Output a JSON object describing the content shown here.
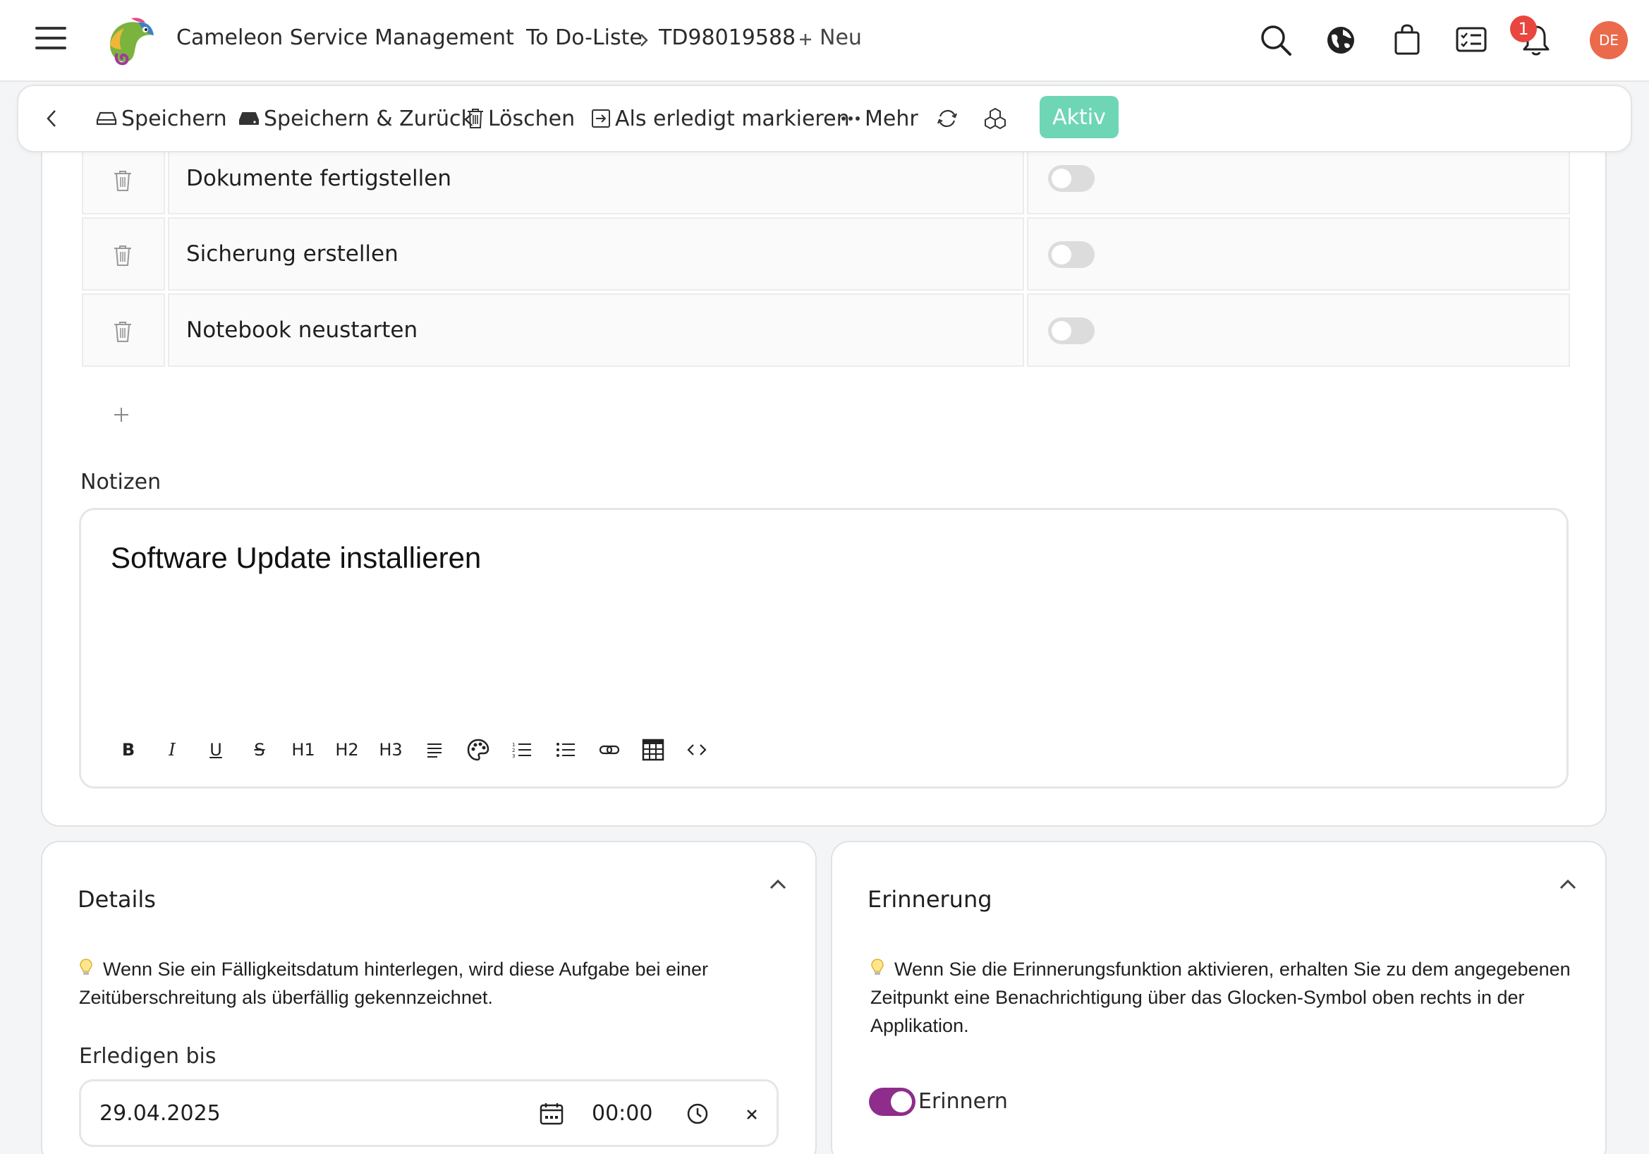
{
  "header": {
    "app_title": "Cameleon Service Management",
    "breadcrumb": {
      "parent": "To Do-Liste",
      "current": "TD98019588"
    },
    "new_label": "Neu",
    "notification_count": "1",
    "avatar_initials": "DE"
  },
  "toolbar": {
    "save_label": "Speichern",
    "save_back_label": "Speichern & Zurück",
    "delete_label": "Löschen",
    "mark_done_label": "Als erledigt markieren",
    "more_label": "Mehr",
    "status_label": "Aktiv",
    "status_color": "#6fd6b5"
  },
  "checklist": {
    "items": [
      {
        "text": "Dokumente fertigstellen",
        "done": false
      },
      {
        "text": "Sicherung erstellen",
        "done": false
      },
      {
        "text": "Notebook neustarten",
        "done": false
      }
    ]
  },
  "notes": {
    "label": "Notizen",
    "content": "Software Update installieren",
    "tools": [
      "B",
      "I",
      "U",
      "S",
      "H1",
      "H2",
      "H3"
    ]
  },
  "details": {
    "title": "Details",
    "hint": "Wenn Sie ein Fälligkeitsdatum hinterlegen, wird diese Aufgabe bei einer Zeitüberschreitung als überfällig gekennzeichnet.",
    "due_label": "Erledigen bis",
    "due_date": "29.04.2025",
    "due_time": "00:00"
  },
  "reminder": {
    "title": "Erinnerung",
    "hint": "Wenn Sie die Erinnerungsfunktion aktivieren, erhalten Sie zu dem angegebenen Zeitpunkt eine Benachrichtigung über das Glocken-Symbol oben rechts in der Applikation.",
    "toggle_label": "Erinnern",
    "enabled": true,
    "toggle_color": "#8e2d8b"
  }
}
